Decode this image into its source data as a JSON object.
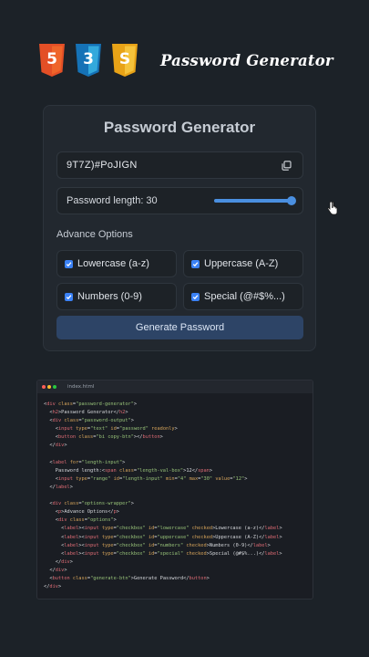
{
  "header": {
    "badges": [
      {
        "label": "5",
        "color": "#e34f26",
        "icon": "html5-icon"
      },
      {
        "label": "3",
        "color": "#1572b6",
        "icon": "css3-icon"
      },
      {
        "label": "S",
        "color": "#f0b429",
        "icon": "javascript-icon"
      }
    ],
    "title": "Password Generator"
  },
  "card": {
    "title": "Password Generator",
    "password": "9T7Z)#PoJIGN",
    "copy_icon": "copy-icon",
    "length_label": "Password length: 30",
    "length": {
      "min": 4,
      "max": 30,
      "value": 30
    },
    "advance_title": "Advance Options",
    "options": [
      {
        "label": "Lowercase (a-z)",
        "checked": true
      },
      {
        "label": "Uppercase (A-Z)",
        "checked": true
      },
      {
        "label": "Numbers (0-9)",
        "checked": true
      },
      {
        "label": "Special (@#$%...)",
        "checked": true
      }
    ],
    "generate_label": "Generate Password",
    "accent": "#4a8fe0"
  },
  "code_window": {
    "filename": "index.html",
    "dots": [
      "#ff5f57",
      "#febc2e",
      "#28c840"
    ],
    "lines": [
      {
        "indent": 0,
        "parts": [
          [
            "p",
            "<"
          ],
          [
            "t",
            "div"
          ],
          [
            "a",
            " class"
          ],
          [
            "p",
            "="
          ],
          [
            "s",
            "\"password-generator\""
          ],
          [
            "p",
            ">"
          ]
        ]
      },
      {
        "indent": 1,
        "parts": [
          [
            "p",
            "<"
          ],
          [
            "t",
            "h2"
          ],
          [
            "p",
            ">Password Generator</"
          ],
          [
            "t",
            "h2"
          ],
          [
            "p",
            ">"
          ]
        ]
      },
      {
        "indent": 1,
        "parts": [
          [
            "p",
            "<"
          ],
          [
            "t",
            "div"
          ],
          [
            "a",
            " class"
          ],
          [
            "p",
            "="
          ],
          [
            "s",
            "\"password-output\""
          ],
          [
            "p",
            ">"
          ]
        ]
      },
      {
        "indent": 2,
        "parts": [
          [
            "p",
            "<"
          ],
          [
            "t",
            "input"
          ],
          [
            "a",
            " type"
          ],
          [
            "p",
            "="
          ],
          [
            "s",
            "\"text\""
          ],
          [
            "a",
            " id"
          ],
          [
            "p",
            "="
          ],
          [
            "s",
            "\"password\""
          ],
          [
            "a",
            " readonly"
          ],
          [
            "p",
            ">"
          ]
        ]
      },
      {
        "indent": 2,
        "parts": [
          [
            "p",
            "<"
          ],
          [
            "t",
            "button"
          ],
          [
            "a",
            " class"
          ],
          [
            "p",
            "="
          ],
          [
            "s",
            "\"bi copy-btn\""
          ],
          [
            "p",
            "></"
          ],
          [
            "t",
            "button"
          ],
          [
            "p",
            ">"
          ]
        ]
      },
      {
        "indent": 1,
        "parts": [
          [
            "p",
            "</"
          ],
          [
            "t",
            "div"
          ],
          [
            "p",
            ">"
          ]
        ]
      },
      {
        "indent": 0,
        "parts": []
      },
      {
        "indent": 1,
        "parts": [
          [
            "p",
            "<"
          ],
          [
            "t",
            "label"
          ],
          [
            "a",
            " for"
          ],
          [
            "p",
            "="
          ],
          [
            "s",
            "\"length-input\""
          ],
          [
            "p",
            ">"
          ]
        ]
      },
      {
        "indent": 2,
        "parts": [
          [
            "p",
            "Password length:<"
          ],
          [
            "t",
            "span"
          ],
          [
            "a",
            " class"
          ],
          [
            "p",
            "="
          ],
          [
            "s",
            "\"length-val-box\""
          ],
          [
            "p",
            ">12</"
          ],
          [
            "t",
            "span"
          ],
          [
            "p",
            ">"
          ]
        ]
      },
      {
        "indent": 2,
        "parts": [
          [
            "p",
            "<"
          ],
          [
            "t",
            "input"
          ],
          [
            "a",
            " type"
          ],
          [
            "p",
            "="
          ],
          [
            "s",
            "\"range\""
          ],
          [
            "a",
            " id"
          ],
          [
            "p",
            "="
          ],
          [
            "s",
            "\"length-input\""
          ],
          [
            "a",
            " min"
          ],
          [
            "p",
            "="
          ],
          [
            "s",
            "\"4\""
          ],
          [
            "a",
            " max"
          ],
          [
            "p",
            "="
          ],
          [
            "s",
            "\"30\""
          ],
          [
            "a",
            " value"
          ],
          [
            "p",
            "="
          ],
          [
            "s",
            "\"12\""
          ],
          [
            "p",
            ">"
          ]
        ]
      },
      {
        "indent": 1,
        "parts": [
          [
            "p",
            "</"
          ],
          [
            "t",
            "label"
          ],
          [
            "p",
            ">"
          ]
        ]
      },
      {
        "indent": 0,
        "parts": []
      },
      {
        "indent": 1,
        "parts": [
          [
            "p",
            "<"
          ],
          [
            "t",
            "div"
          ],
          [
            "a",
            " class"
          ],
          [
            "p",
            "="
          ],
          [
            "s",
            "\"options-wrapper\""
          ],
          [
            "p",
            ">"
          ]
        ]
      },
      {
        "indent": 2,
        "parts": [
          [
            "p",
            "<"
          ],
          [
            "t",
            "p"
          ],
          [
            "p",
            ">Advance Options</"
          ],
          [
            "t",
            "p"
          ],
          [
            "p",
            ">"
          ]
        ]
      },
      {
        "indent": 2,
        "parts": [
          [
            "p",
            "<"
          ],
          [
            "t",
            "div"
          ],
          [
            "a",
            " class"
          ],
          [
            "p",
            "="
          ],
          [
            "s",
            "\"options\""
          ],
          [
            "p",
            ">"
          ]
        ]
      },
      {
        "indent": 3,
        "parts": [
          [
            "p",
            "<"
          ],
          [
            "t",
            "label"
          ],
          [
            "p",
            "><"
          ],
          [
            "t",
            "input"
          ],
          [
            "a",
            " type"
          ],
          [
            "p",
            "="
          ],
          [
            "s",
            "\"checkbox\""
          ],
          [
            "a",
            " id"
          ],
          [
            "p",
            "="
          ],
          [
            "s",
            "\"lowercase\""
          ],
          [
            "a",
            " checked"
          ],
          [
            "p",
            ">Lowercase (a-z)</"
          ],
          [
            "t",
            "label"
          ],
          [
            "p",
            ">"
          ]
        ]
      },
      {
        "indent": 3,
        "parts": [
          [
            "p",
            "<"
          ],
          [
            "t",
            "label"
          ],
          [
            "p",
            "><"
          ],
          [
            "t",
            "input"
          ],
          [
            "a",
            " type"
          ],
          [
            "p",
            "="
          ],
          [
            "s",
            "\"checkbox\""
          ],
          [
            "a",
            " id"
          ],
          [
            "p",
            "="
          ],
          [
            "s",
            "\"uppercase\""
          ],
          [
            "a",
            " checked"
          ],
          [
            "p",
            ">Uppercase (A-Z)</"
          ],
          [
            "t",
            "label"
          ],
          [
            "p",
            ">"
          ]
        ]
      },
      {
        "indent": 3,
        "parts": [
          [
            "p",
            "<"
          ],
          [
            "t",
            "label"
          ],
          [
            "p",
            "><"
          ],
          [
            "t",
            "input"
          ],
          [
            "a",
            " type"
          ],
          [
            "p",
            "="
          ],
          [
            "s",
            "\"checkbox\""
          ],
          [
            "a",
            " id"
          ],
          [
            "p",
            "="
          ],
          [
            "s",
            "\"numbers\""
          ],
          [
            "a",
            " checked"
          ],
          [
            "p",
            ">Numbers (0-9)</"
          ],
          [
            "t",
            "label"
          ],
          [
            "p",
            ">"
          ]
        ]
      },
      {
        "indent": 3,
        "parts": [
          [
            "p",
            "<"
          ],
          [
            "t",
            "label"
          ],
          [
            "p",
            "><"
          ],
          [
            "t",
            "input"
          ],
          [
            "a",
            " type"
          ],
          [
            "p",
            "="
          ],
          [
            "s",
            "\"checkbox\""
          ],
          [
            "a",
            " id"
          ],
          [
            "p",
            "="
          ],
          [
            "s",
            "\"special\""
          ],
          [
            "a",
            " checked"
          ],
          [
            "p",
            ">Special (@#$%...)</"
          ],
          [
            "t",
            "label"
          ],
          [
            "p",
            ">"
          ]
        ]
      },
      {
        "indent": 2,
        "parts": [
          [
            "p",
            "</"
          ],
          [
            "t",
            "div"
          ],
          [
            "p",
            ">"
          ]
        ]
      },
      {
        "indent": 1,
        "parts": [
          [
            "p",
            "</"
          ],
          [
            "t",
            "div"
          ],
          [
            "p",
            ">"
          ]
        ]
      },
      {
        "indent": 1,
        "parts": [
          [
            "p",
            "<"
          ],
          [
            "t",
            "button"
          ],
          [
            "a",
            " class"
          ],
          [
            "p",
            "="
          ],
          [
            "s",
            "\"generate-btn\""
          ],
          [
            "p",
            ">Generate Password</"
          ],
          [
            "t",
            "button"
          ],
          [
            "p",
            ">"
          ]
        ]
      },
      {
        "indent": 0,
        "parts": [
          [
            "p",
            "</"
          ],
          [
            "t",
            "div"
          ],
          [
            "p",
            ">"
          ]
        ]
      }
    ]
  }
}
